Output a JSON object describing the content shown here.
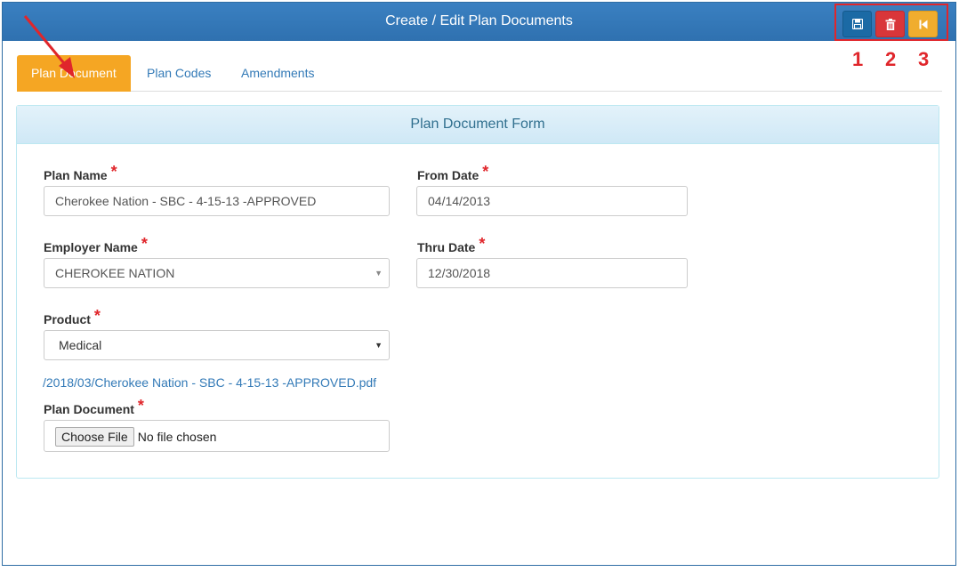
{
  "window": {
    "title": "Create / Edit Plan Documents"
  },
  "actions": {
    "save_icon": "floppy-disk-icon",
    "delete_icon": "trash-icon",
    "back_icon": "skip-back-icon",
    "save_color": "#1b6aa5",
    "delete_color": "#d9363a",
    "back_color": "#f0ad2e",
    "annotations": [
      "1",
      "2",
      "3"
    ]
  },
  "tabs": [
    {
      "label": "Plan Document",
      "active": true
    },
    {
      "label": "Plan Codes",
      "active": false
    },
    {
      "label": "Amendments",
      "active": false
    }
  ],
  "form": {
    "heading": "Plan Document Form",
    "plan_name": {
      "label": "Plan Name",
      "required": "*",
      "value": "Cherokee Nation - SBC  -  4-15-13 -APPROVED"
    },
    "employer_name": {
      "label": "Employer Name",
      "required": "*",
      "value": "CHEROKEE NATION"
    },
    "product": {
      "label": "Product",
      "required": "*",
      "value": "Medical"
    },
    "from_date": {
      "label": "From Date",
      "required": "*",
      "value": "04/14/2013"
    },
    "thru_date": {
      "label": "Thru Date",
      "required": "*",
      "value": "12/30/2018"
    },
    "file_link": "/2018/03/Cherokee Nation - SBC - 4-15-13 -APPROVED.pdf",
    "plan_document": {
      "label": "Plan Document",
      "required": "*",
      "button": "Choose File",
      "status": "No file chosen"
    }
  },
  "colors": {
    "accent_tab": "#f5a623",
    "titlebar": "#2f71b0",
    "annotation_red": "#e0262b"
  }
}
